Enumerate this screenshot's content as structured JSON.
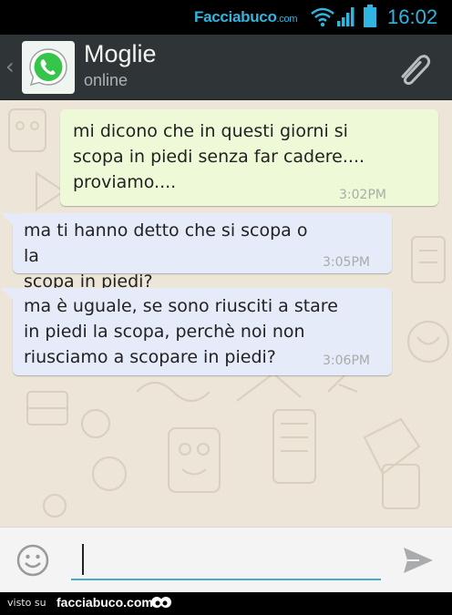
{
  "status_bar": {
    "brand": "Facciabuco",
    "brand_suffix": ".com",
    "time": "16:02",
    "icons": [
      "wifi-icon",
      "signal-icon",
      "battery-icon"
    ],
    "accent_color": "#2fb5e0"
  },
  "header": {
    "back_glyph": "‹",
    "avatar_icon": "whatsapp-logo",
    "contact_name": "Moglie",
    "contact_status": "online",
    "attach_icon": "paperclip-icon",
    "background_color": "#2f3537"
  },
  "messages": [
    {
      "direction": "outgoing",
      "text": "mi dicono che in questi giorni si\nscopa in piedi senza far cadere....\nproviamo....",
      "time": "3:02PM",
      "status_icon": "double-check-icon",
      "bubble_color": "#eefad7"
    },
    {
      "direction": "incoming",
      "text": "ma ti hanno detto che si scopa o la\nscopa in piedi?",
      "time": "3:05PM",
      "bubble_color": "#e6ebf9"
    },
    {
      "direction": "incoming",
      "text": "ma è uguale, se sono riusciti a stare\nin piedi la scopa, perchè noi non\nriusciamo a scopare in piedi?",
      "time": "3:06PM",
      "bubble_color": "#e6ebf9"
    }
  ],
  "composer": {
    "emoji_icon": "smiley-icon",
    "input_value": "",
    "send_icon": "send-icon"
  },
  "watermark": {
    "prefix": "visto su",
    "site": "facciabuco.com"
  }
}
